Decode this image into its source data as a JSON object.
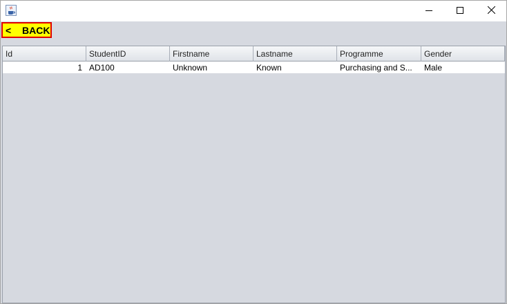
{
  "window": {
    "app_icon": "java-coffee-icon",
    "controls": {
      "minimize": "minimize-icon",
      "maximize": "maximize-icon",
      "close": "close-icon"
    }
  },
  "toolbar": {
    "back_chevron": "<",
    "back_label": "BACK",
    "back_bg": "#ffff00",
    "back_border": "#e00000"
  },
  "table": {
    "columns": [
      "Id",
      "StudentID",
      "Firstname",
      "Lastname",
      "Programme",
      "Gender"
    ],
    "rows": [
      [
        "1",
        "AD100",
        "Unknown",
        "Known",
        "Purchasing and S...",
        "Male"
      ]
    ]
  }
}
